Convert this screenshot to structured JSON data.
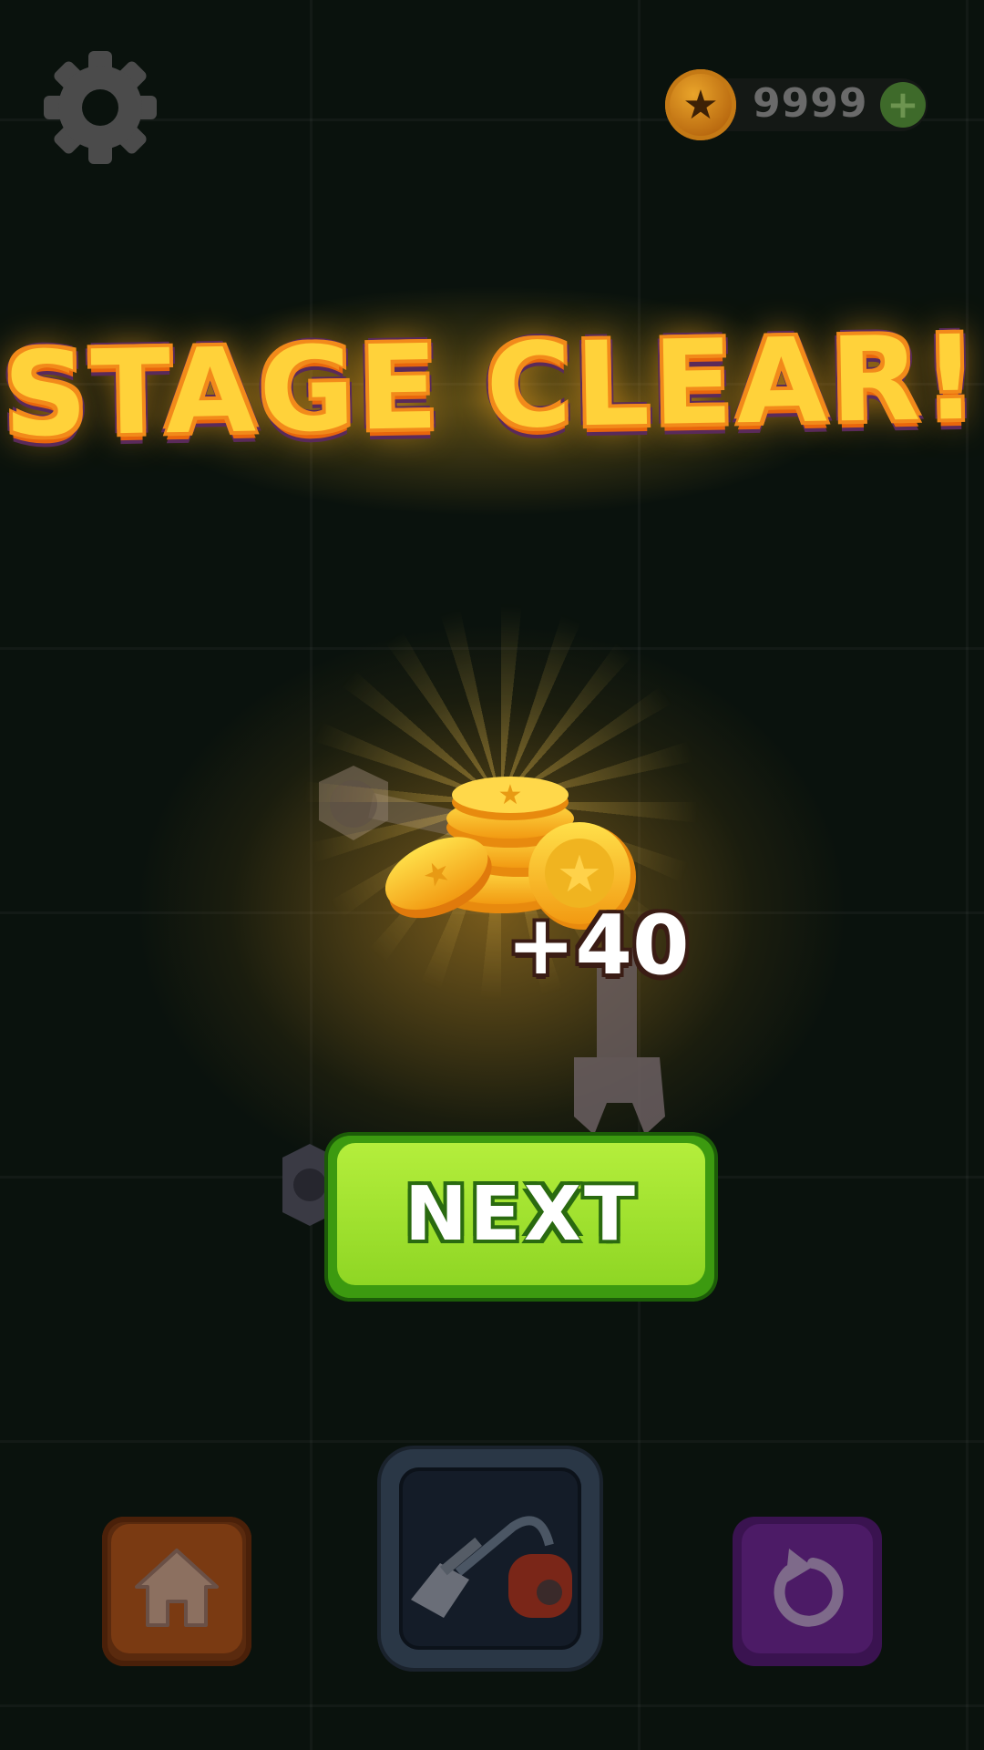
{
  "hud": {
    "coins": "9999",
    "settings_icon": "gear-icon",
    "coin_icon": "coin-star-icon",
    "add_icon": "plus-icon"
  },
  "result": {
    "title": "STAGE CLEAR!",
    "reward": "+40",
    "reward_icon": "coin-pile-icon"
  },
  "actions": {
    "next_label": "NEXT",
    "home_icon": "home-icon",
    "booster_icon": "vacuum-cleaner-icon",
    "retry_icon": "restart-icon"
  },
  "colors": {
    "background": "#0a120d",
    "title_fill": "#ffd23a",
    "title_outline": "#f28a1a",
    "next_button": "#8fd624",
    "home_button": "#7a3a12",
    "retry_button": "#4c1b66"
  }
}
